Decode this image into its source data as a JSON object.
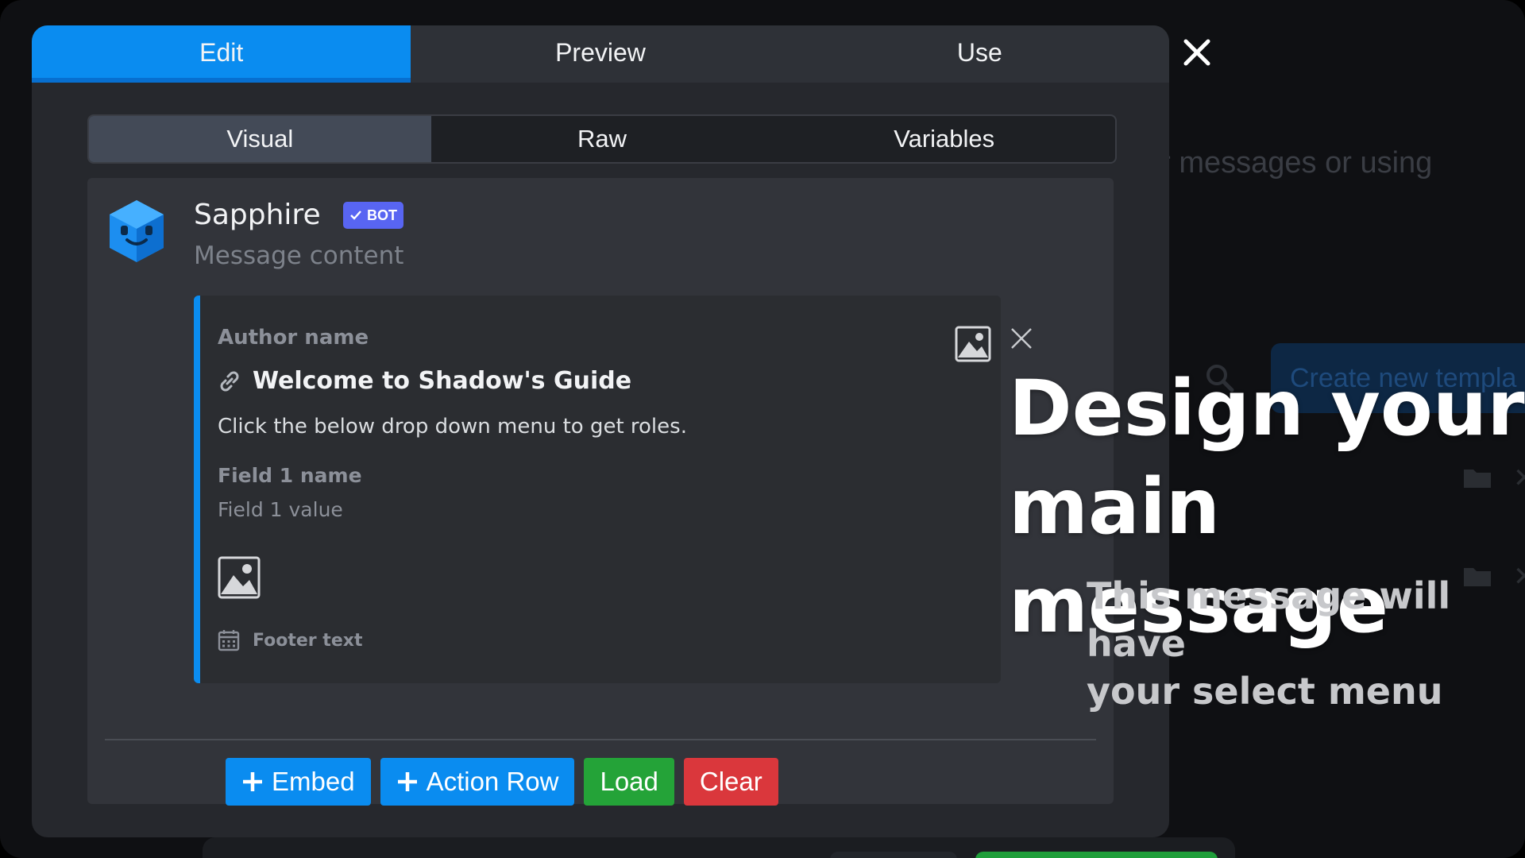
{
  "background": {
    "partial_text": "er messages or using",
    "create_button_label": "Create new templa"
  },
  "tabs": {
    "top": [
      {
        "label": "Edit",
        "active": true
      },
      {
        "label": "Preview",
        "active": false
      },
      {
        "label": "Use",
        "active": false
      }
    ],
    "sub": [
      {
        "label": "Visual",
        "active": true
      },
      {
        "label": "Raw",
        "active": false
      },
      {
        "label": "Variables",
        "active": false
      }
    ]
  },
  "message": {
    "username": "Sapphire",
    "badge": "BOT",
    "content_placeholder": "Message content",
    "embed": {
      "author": "Author name",
      "title": "Welcome to Shadow's Guide",
      "description": "Click the below drop down menu to get roles.",
      "field_name": "Field 1 name",
      "field_value": "Field 1 value",
      "footer": "Footer text",
      "accent_color": "#0a8cf0"
    }
  },
  "actions": {
    "embed_label": "Embed",
    "action_row_label": "Action Row",
    "load_label": "Load",
    "clear_label": "Clear"
  },
  "overlay": {
    "heading_line1": "Design your",
    "heading_line2": "main message",
    "sub_line1": "This message will have",
    "sub_line2": "your select menu"
  },
  "icons": {
    "close": "close-icon",
    "link": "link-icon",
    "image": "image-icon",
    "calendar": "calendar-icon",
    "plus": "plus-icon",
    "check": "check-icon",
    "search": "search-icon",
    "folder": "folder-icon"
  },
  "colors": {
    "primary": "#0a8cf0",
    "success": "#24a338",
    "danger": "#da373c",
    "badge": "#5865f2"
  }
}
